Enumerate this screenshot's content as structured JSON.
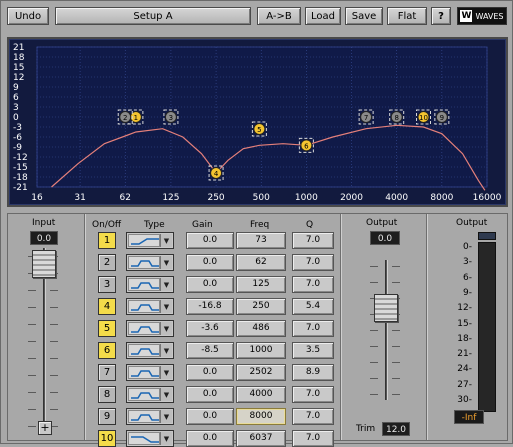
{
  "toolbar": {
    "undo": "Undo",
    "preset": "Setup A",
    "ab": "A->B",
    "load": "Load",
    "save": "Save",
    "flat": "Flat",
    "help": "?",
    "brand": "WAVES"
  },
  "graph": {
    "y_labels": [
      "21",
      "18",
      "15",
      "12",
      "9",
      "6",
      "3",
      "0",
      "-3",
      "-6",
      "-9",
      "-12",
      "-15",
      "-18",
      "-21"
    ],
    "x_labels": [
      "16",
      "31",
      "62",
      "125",
      "250",
      "500",
      "1000",
      "2000",
      "4000",
      "8000",
      "16000"
    ],
    "y_range": [
      -21,
      21
    ],
    "x_range_hz": [
      16,
      16000
    ],
    "x_scale": "log",
    "markers": [
      {
        "band": "1",
        "freq": 73,
        "gain": 0.0,
        "active": true
      },
      {
        "band": "2",
        "freq": 62,
        "gain": 0.0,
        "active": false
      },
      {
        "band": "3",
        "freq": 125,
        "gain": 0.0,
        "active": false
      },
      {
        "band": "4",
        "freq": 250,
        "gain": -16.8,
        "active": true
      },
      {
        "band": "5",
        "freq": 486,
        "gain": -3.6,
        "active": true
      },
      {
        "band": "6",
        "freq": 1000,
        "gain": -8.5,
        "active": true
      },
      {
        "band": "7",
        "freq": 2502,
        "gain": 0.0,
        "active": false
      },
      {
        "band": "8",
        "freq": 4000,
        "gain": 0.0,
        "active": false
      },
      {
        "band": "9",
        "freq": 8000,
        "gain": 0.0,
        "active": false
      },
      {
        "band": "10",
        "freq": 6037,
        "gain": 0.0,
        "active": true
      }
    ],
    "curve": [
      {
        "f": 20,
        "g": -21
      },
      {
        "f": 30,
        "g": -14
      },
      {
        "f": 45,
        "g": -8
      },
      {
        "f": 73,
        "g": -4.5
      },
      {
        "f": 110,
        "g": -3.5
      },
      {
        "f": 150,
        "g": -6
      },
      {
        "f": 200,
        "g": -11
      },
      {
        "f": 250,
        "g": -16.8
      },
      {
        "f": 300,
        "g": -13
      },
      {
        "f": 380,
        "g": -9.5
      },
      {
        "f": 486,
        "g": -8.5
      },
      {
        "f": 700,
        "g": -8
      },
      {
        "f": 1000,
        "g": -8.5
      },
      {
        "f": 1500,
        "g": -6
      },
      {
        "f": 2502,
        "g": -3.5
      },
      {
        "f": 4000,
        "g": -2.5
      },
      {
        "f": 6037,
        "g": -3
      },
      {
        "f": 8000,
        "g": -5
      },
      {
        "f": 11000,
        "g": -11
      },
      {
        "f": 14000,
        "g": -19
      },
      {
        "f": 15500,
        "g": -22
      }
    ],
    "colors": {
      "bg": "#121a3e",
      "grid": "#3a4f9a",
      "curve": "#e5807a",
      "label": "#ffffff",
      "marker_active": "#f4c430"
    }
  },
  "input": {
    "title": "Input",
    "value": "0.0",
    "plus": "+"
  },
  "headers": {
    "onoff": "On/Off",
    "type": "Type",
    "gain": "Gain",
    "freq": "Freq",
    "q": "Q"
  },
  "bands": [
    {
      "num": "1",
      "on": true,
      "shape": "low-shelf",
      "gain": "0.0",
      "freq": "73",
      "q": "7.0"
    },
    {
      "num": "2",
      "on": false,
      "shape": "bell",
      "gain": "0.0",
      "freq": "62",
      "q": "7.0"
    },
    {
      "num": "3",
      "on": false,
      "shape": "bell",
      "gain": "0.0",
      "freq": "125",
      "q": "7.0"
    },
    {
      "num": "4",
      "on": true,
      "shape": "bell",
      "gain": "-16.8",
      "freq": "250",
      "q": "5.4"
    },
    {
      "num": "5",
      "on": true,
      "shape": "bell",
      "gain": "-3.6",
      "freq": "486",
      "q": "7.0"
    },
    {
      "num": "6",
      "on": true,
      "shape": "bell",
      "gain": "-8.5",
      "freq": "1000",
      "q": "3.5"
    },
    {
      "num": "7",
      "on": false,
      "shape": "bell",
      "gain": "0.0",
      "freq": "2502",
      "q": "8.9"
    },
    {
      "num": "8",
      "on": false,
      "shape": "bell",
      "gain": "0.0",
      "freq": "4000",
      "q": "7.0"
    },
    {
      "num": "9",
      "on": false,
      "shape": "bell",
      "gain": "0.0",
      "freq": "8000",
      "q": "7.0",
      "selected": true
    },
    {
      "num": "10",
      "on": true,
      "shape": "high-shelf",
      "gain": "0.0",
      "freq": "6037",
      "q": "7.0"
    }
  ],
  "output_fader": {
    "title": "Output",
    "value": "0.0",
    "trim_label": "Trim",
    "trim_value": "12.0"
  },
  "output_meter": {
    "title": "Output",
    "scale": [
      "0-",
      "3-",
      "6-",
      "9-",
      "12-",
      "15-",
      "18-",
      "21-",
      "24-",
      "27-",
      "30-"
    ],
    "peak": "-Inf"
  }
}
